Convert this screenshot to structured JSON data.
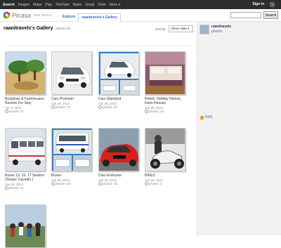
{
  "topnav": [
    "Search",
    "Images",
    "Maps",
    "Play",
    "YouTube",
    "News",
    "Gmail",
    "Drive",
    "More ▾"
  ],
  "signin": "Sign in",
  "logo": {
    "word": "Picasa",
    "sub": "Web Albums"
  },
  "tabs": [
    "Explore",
    "raanitravels's Gallery"
  ],
  "search": {
    "button": "Search",
    "value": ""
  },
  "gallery": {
    "title": "raanitravels's Gallery",
    "count": "Albums (9)",
    "sort_label": "Sort by:",
    "sort_value": "Album date ▾"
  },
  "sidebar": {
    "name": "raanitravels",
    "photos_link": "photos",
    "rss": "RSS"
  },
  "albums": [
    {
      "title": "Bunglows & Farmhouses, Resorts For Stay",
      "date": "Apr 4, 2013",
      "photos": "photos: 47"
    },
    {
      "title": "Cars Premium",
      "date": "Jan 29, 2013",
      "photos": "photos: 75"
    },
    {
      "title": "Cars Standard",
      "date": "Jan 29, 2013",
      "photos": "photos: 40"
    },
    {
      "title": "Hotels, Holiday Homes, Farm Houses",
      "date": "Jan 29, 2013",
      "photos": "photos: 18"
    },
    {
      "title": "Buses 13, 15, 17 Seaters (Tempo Traveller )",
      "date": "Jan 29, 2013",
      "photos": "photos: 41"
    },
    {
      "title": "Buses",
      "date": "Jan 29, 2013",
      "photos": "photos: 25"
    },
    {
      "title": "Cars Exclusive",
      "date": "Jan 29, 2013",
      "photos": "photos: 50"
    },
    {
      "title": "BIKES",
      "date": "Jan 29, 2013",
      "photos": "photos: 4"
    },
    {
      "title": "",
      "date": "",
      "photos": ""
    }
  ]
}
